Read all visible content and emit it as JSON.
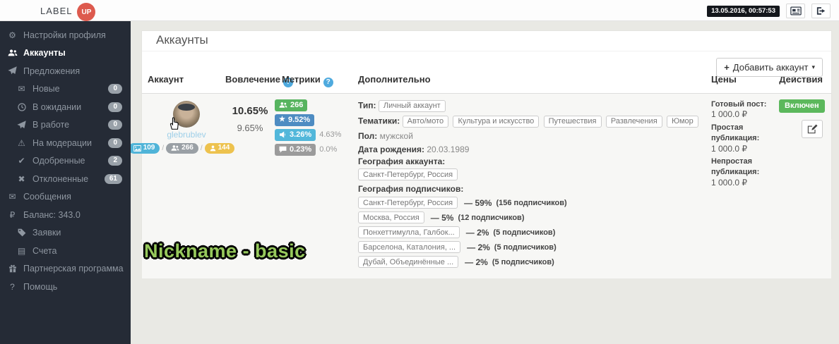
{
  "topbar": {
    "logo_text": "LABEL",
    "logo_badge": "UP",
    "timestamp": "13.05.2016, 00:57:53"
  },
  "icons": {
    "gear": "⚙",
    "envelope": "✉",
    "warning": "⚠",
    "check": "✔",
    "cross": "✖",
    "ruble": "₽",
    "card": "▤",
    "question": "?",
    "star": "★",
    "plus": "+",
    "caret": "▾",
    "slash": "/"
  },
  "sidebar": {
    "items": [
      {
        "label": "Настройки профиля"
      },
      {
        "label": "Аккаунты"
      },
      {
        "label": "Предложения"
      },
      {
        "label": "Новые",
        "badge": "0"
      },
      {
        "label": "В ожидании",
        "badge": "0"
      },
      {
        "label": "В работе",
        "badge": "0"
      },
      {
        "label": "На модерации",
        "badge": "0"
      },
      {
        "label": "Одобренные",
        "badge": "2"
      },
      {
        "label": "Отклоненные",
        "badge": "61"
      },
      {
        "label": "Сообщения"
      },
      {
        "label": "Баланс: 343.0"
      },
      {
        "label": "Заявки"
      },
      {
        "label": "Счета"
      },
      {
        "label": "Партнерская программа"
      },
      {
        "label": "Помощь"
      }
    ]
  },
  "page": {
    "title": "Аккаунты",
    "add_account_label": "Добавить аккаунт"
  },
  "table": {
    "headers": {
      "account": "Аккаунт",
      "engagement": "Вовлечение",
      "metrics": "Метрики",
      "extra": "Дополнительно",
      "prices": "Цены",
      "actions": "Действия"
    },
    "row": {
      "username": "glebrublev",
      "counts": {
        "photos": "109",
        "followers": "266",
        "following": "144"
      },
      "engagement": {
        "primary": "10.65%",
        "secondary": "9.65%"
      },
      "metrics": {
        "followers": "266",
        "likes": "9.52%",
        "reach": "3.26%",
        "reach_alt": "4.63%",
        "comments": "0.23%",
        "comments_alt": "0.0%"
      },
      "extra": {
        "type_label": "Тип:",
        "type_value": "Личный аккаунт",
        "topics_label": "Тематики:",
        "topics": [
          "Авто/мото",
          "Культура и искусство",
          "Путешествия",
          "Развлечения",
          "Юмор"
        ],
        "gender_label": "Пол:",
        "gender_value": "мужской",
        "birthdate_label": "Дата рождения:",
        "birthdate_value": "20.03.1989",
        "account_geo_label": "География аккаунта:",
        "account_geo": "Санкт-Петербург, Россия",
        "followers_geo_label": "География подписчиков:",
        "followers_geo": [
          {
            "place": "Санкт-Петербург, Россия",
            "share": "— 59%",
            "count": "(156 подписчиков)"
          },
          {
            "place": "Москва, Россия",
            "share": "— 5%",
            "count": "(12 подписчиков)"
          },
          {
            "place": "Понхеттимулла, Галбок...",
            "share": "— 2%",
            "count": "(5 подписчиков)"
          },
          {
            "place": "Барселона, Каталония, ...",
            "share": "— 2%",
            "count": "(5 подписчиков)"
          },
          {
            "place": "Дубай, Объединённые ...",
            "share": "— 2%",
            "count": "(5 подписчиков)"
          }
        ]
      },
      "prices": [
        {
          "label": "Готовый пост:",
          "value": "1 000.0 ₽"
        },
        {
          "label": "Простая публикация:",
          "value": "1 000.0 ₽"
        },
        {
          "label": "Непростая публикация:",
          "value": "1 000.0 ₽"
        }
      ],
      "status": "Включен"
    }
  },
  "subtitle": "Nickname - basic",
  "colors": {
    "accent_red": "#dd5a4e",
    "sidebar_bg": "#252b36",
    "success_green": "#5cb85c",
    "info_blue": "#50b4d8",
    "primary_blue": "#4e8cc2",
    "warning_yellow": "#edc24e",
    "subtitle_green": "#97c95c"
  }
}
